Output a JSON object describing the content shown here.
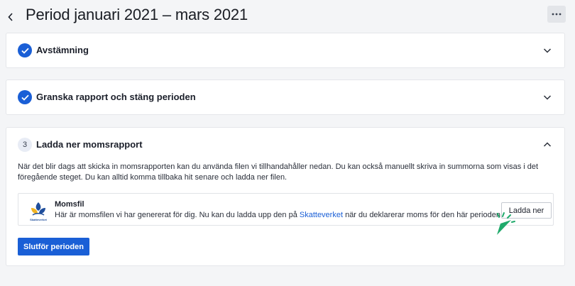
{
  "header": {
    "title": "Period januari 2021 – mars 2021",
    "back_icon": "chevron-left-icon",
    "more_icon": "more-horizontal-icon"
  },
  "steps": [
    {
      "label": "Avstämning",
      "status": "completed",
      "icon": "check-icon",
      "expand_icon": "chevron-down-icon"
    },
    {
      "label": "Granska rapport och stäng perioden",
      "status": "completed",
      "icon": "check-icon",
      "expand_icon": "chevron-down-icon"
    },
    {
      "number": "3",
      "label": "Ladda ner momsrapport",
      "status": "active",
      "expand_icon": "chevron-up-icon"
    }
  ],
  "download_section": {
    "description": "När det blir dags att skicka in momsrapporten kan du använda filen vi tillhandahåller nedan. Du kan också manuellt skriva in summorna som visas i det föregående steget. Du kan alltid komma tillbaka hit senare och ladda ner filen.",
    "file": {
      "name": "Momsfil",
      "description_before": "Här är momsfilen vi har genererat för dig. Nu kan du ladda upp den på ",
      "link_text": "Skatteverket",
      "description_after": " när du deklarerar moms för den här perioden.",
      "logo_text": "Skatteverket",
      "download_label": "Ladda ner"
    },
    "finish_label": "Slutför perioden"
  },
  "colors": {
    "primary": "#1a5fd6",
    "background": "#f4f5f7",
    "cursor": "#1faa6b"
  }
}
